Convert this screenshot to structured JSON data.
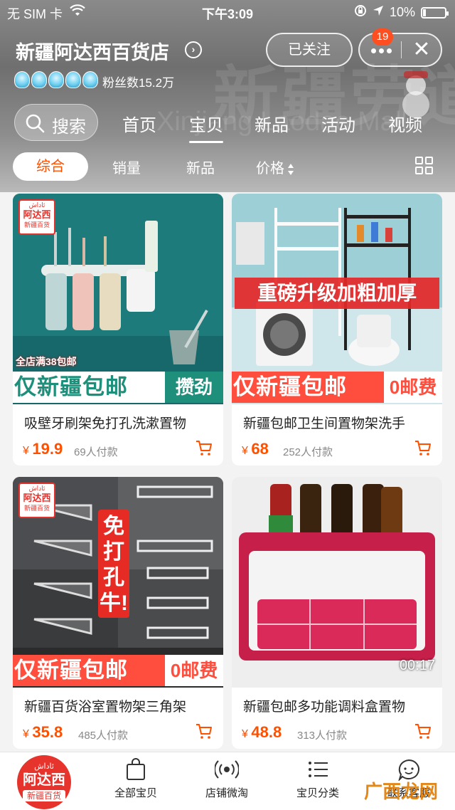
{
  "status_bar": {
    "carrier": "无 SIM 卡",
    "time": "下午3:09",
    "battery_percent": "10%"
  },
  "store": {
    "name": "新疆阿达西百货店",
    "fans": "粉丝数15.2万",
    "crown_level": 5,
    "follow_label": "已关注",
    "notification_count": "19",
    "watermark": "新疆劳道商城",
    "watermark_en": "Xinjiang Laodao Mall"
  },
  "search": {
    "label": "搜索"
  },
  "tabs": [
    {
      "label": "首页",
      "active": false
    },
    {
      "label": "宝贝",
      "active": true
    },
    {
      "label": "新品",
      "active": false
    },
    {
      "label": "活动",
      "active": false
    },
    {
      "label": "视频",
      "active": false
    }
  ],
  "filters": {
    "comprehensive": "综合",
    "sales": "销量",
    "new": "新品",
    "price": "价格"
  },
  "logo": {
    "top": "ئاداش",
    "mid": "阿达西",
    "bottom": "新疆百货"
  },
  "products": [
    {
      "title": "吸壁牙刷架免打孔洗漱置物",
      "currency": "¥",
      "price": "19.9",
      "sold": "69人付款",
      "promo_tag": "全店满38包邮",
      "banner_left": "仅新疆包邮",
      "banner_right": "攒劲"
    },
    {
      "title": "新疆包邮卫生间置物架洗手",
      "currency": "¥",
      "price": "68",
      "sold": "252人付款",
      "headline": "重磅升级加粗加厚",
      "banner_left": "仅新疆包邮",
      "banner_right": "0邮费"
    },
    {
      "title": "新疆百货浴室置物架三角架",
      "currency": "¥",
      "price": "35.8",
      "sold": "485人付款",
      "sticker": "免打孔牛!",
      "banner_left": "仅新疆包邮",
      "banner_right": "0邮费"
    },
    {
      "title": "新疆包邮多功能调料盒置物",
      "currency": "¥",
      "price": "48.8",
      "sold": "313人付款",
      "video_time": "00:17"
    }
  ],
  "bottom_nav": [
    {
      "label": "全部宝贝",
      "icon": "bag-icon"
    },
    {
      "label": "店铺微淘",
      "icon": "broadcast-icon"
    },
    {
      "label": "宝贝分类",
      "icon": "list-icon"
    },
    {
      "label": "联系客服",
      "icon": "chat-icon"
    }
  ],
  "corner_watermark": "广西龙网",
  "colors": {
    "accent": "#ff5000",
    "promo_red": "#ff4e3d",
    "promo_green": "#1d8f7a",
    "badge": "#ff4e1f"
  }
}
